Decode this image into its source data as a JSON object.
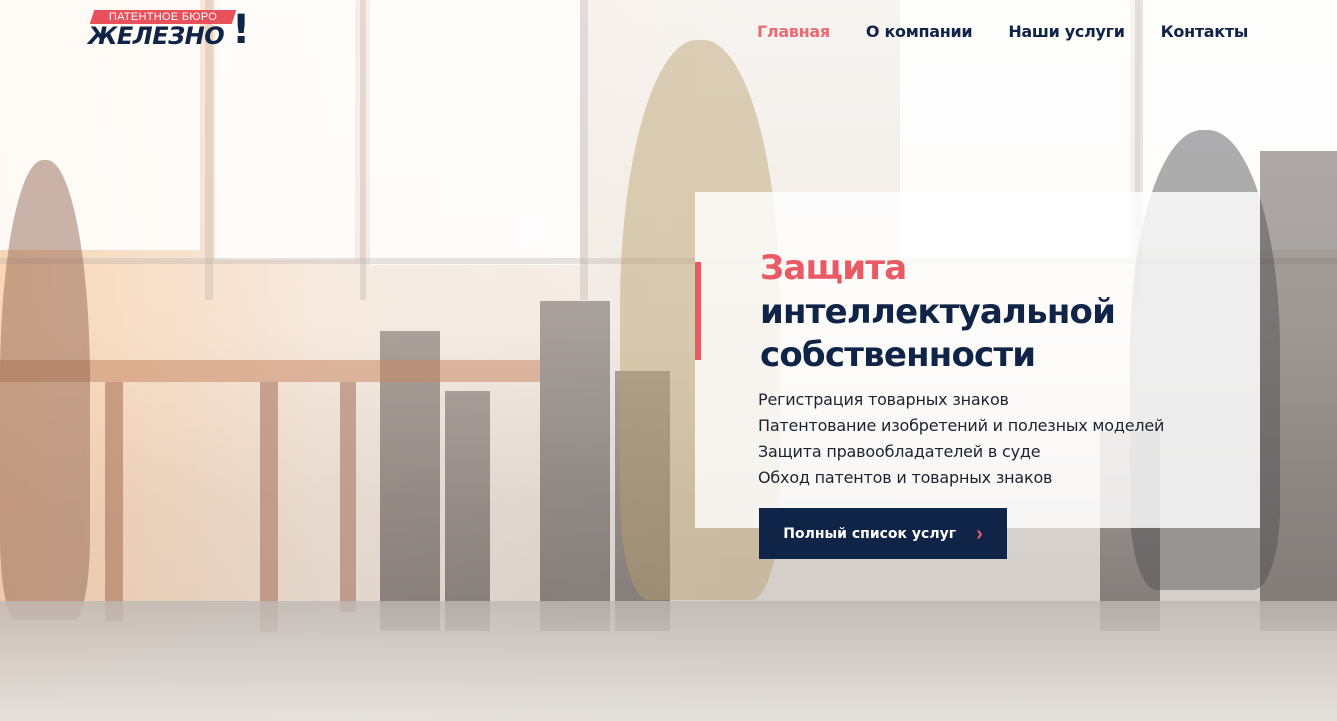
{
  "header": {
    "logo": {
      "small_text": "ПАТЕНТНОЕ БЮРО",
      "big_text": "ЖЕЛЕЗНО",
      "mark": "!"
    },
    "nav": [
      {
        "label": "Главная",
        "active": true
      },
      {
        "label": "О компании",
        "active": false
      },
      {
        "label": "Наши услуги",
        "active": false
      },
      {
        "label": "Контакты",
        "active": false
      }
    ]
  },
  "hero": {
    "headline": [
      "Защита",
      "интеллектуальной",
      "собственности"
    ],
    "services": [
      "Регистрация товарных знаков",
      "Патентование изобретений и полезных моделей",
      "Защита правообладателей в суде",
      "Обход патентов и товарных знаков"
    ],
    "cta": {
      "label": "Полный список услуг",
      "icon": "chevron-right-icon"
    }
  },
  "colors": {
    "brand_navy": "#0f2447",
    "accent_red": "#ea5a65",
    "nav_active": "#ea6b75"
  }
}
